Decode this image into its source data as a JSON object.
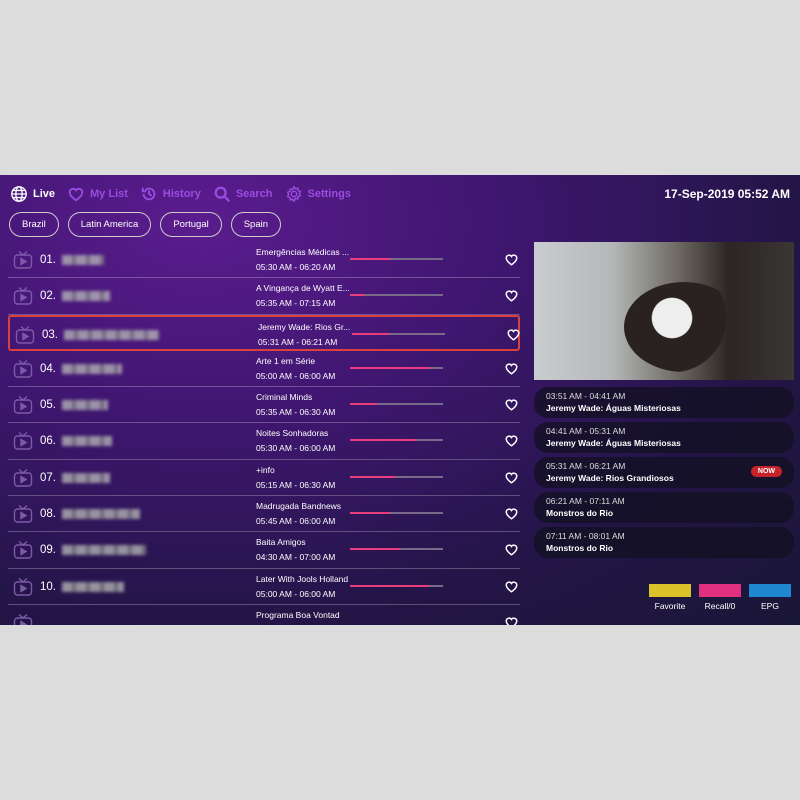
{
  "nav": [
    {
      "label": "Live",
      "icon": "globe-icon",
      "active": true
    },
    {
      "label": "My List",
      "icon": "heart-icon"
    },
    {
      "label": "History",
      "icon": "history-icon"
    },
    {
      "label": "Search",
      "icon": "search-icon"
    },
    {
      "label": "Settings",
      "icon": "gear-icon"
    }
  ],
  "clock": "17-Sep-2019 05:52 AM",
  "categories": [
    "Brazil",
    "Latin America",
    "Portugal",
    "Spain"
  ],
  "channels": [
    {
      "num": "01.",
      "program": "Emergências Médicas ...",
      "time": "05:30 AM - 06:20 AM",
      "progress": 0.43
    },
    {
      "num": "02.",
      "program": "A Vingança de Wyatt E...",
      "time": "05:35 AM - 07:15 AM",
      "progress": 0.16
    },
    {
      "num": "03.",
      "program": "Jeremy Wade: Rios Gr...",
      "time": "05:31 AM - 06:21 AM",
      "progress": 0.4,
      "selected": true
    },
    {
      "num": "04.",
      "program": "Arte 1 em Série",
      "time": "05:00 AM - 06:00 AM",
      "progress": 0.86
    },
    {
      "num": "05.",
      "program": "Criminal Minds",
      "time": "05:35 AM - 06:30 AM",
      "progress": 0.29
    },
    {
      "num": "06.",
      "program": "Noites Sonhadoras",
      "time": "05:30 AM - 06:00 AM",
      "progress": 0.71
    },
    {
      "num": "07.",
      "program": "+info",
      "time": "05:15 AM - 06:30 AM",
      "progress": 0.48
    },
    {
      "num": "08.",
      "program": "Madrugada Bandnews",
      "time": "05:45 AM - 06:00 AM",
      "progress": 0.43
    },
    {
      "num": "09.",
      "program": "Baita Amigos",
      "time": "04:30 AM - 07:00 AM",
      "progress": 0.54
    },
    {
      "num": "10.",
      "program": "Later With Jools Holland",
      "time": "05:00 AM - 06:00 AM",
      "progress": 0.85
    },
    {
      "num": "",
      "program": "Programa Boa Vontad",
      "time": "",
      "progress": 0
    }
  ],
  "epg": [
    {
      "time": "03:51 AM - 04:41 AM",
      "title": "Jeremy Wade: Águas Misteriosas"
    },
    {
      "time": "04:41 AM - 05:31 AM",
      "title": "Jeremy Wade: Águas Misteriosas"
    },
    {
      "time": "05:31 AM - 06:21 AM",
      "title": "Jeremy Wade: Rios Grandiosos",
      "badge": "NOW"
    },
    {
      "time": "06:21 AM - 07:11 AM",
      "title": "Monstros do Rio"
    },
    {
      "time": "07:11 AM - 08:01 AM",
      "title": "Monstros do Rio"
    }
  ],
  "keys": [
    {
      "label": "Favorite",
      "color": "#d9c22a"
    },
    {
      "label": "Recall/0",
      "color": "#e0307f"
    },
    {
      "label": "EPG",
      "color": "#1f86d0"
    }
  ],
  "colors": {
    "accent": "#9a4de0",
    "progress": "#e83e7e",
    "selection": "#d9413f",
    "now_badge": "#c4232a"
  }
}
